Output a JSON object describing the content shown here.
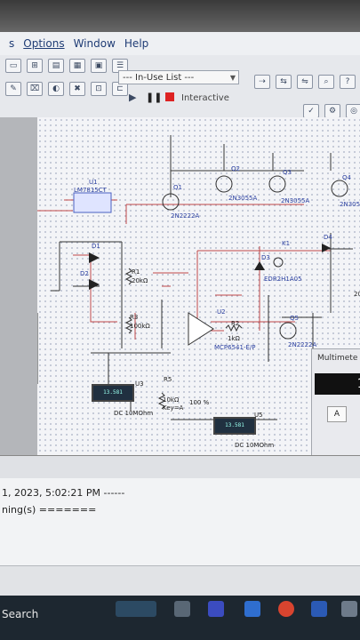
{
  "menubar": {
    "items": [
      "s",
      "Options",
      "Window",
      "Help"
    ]
  },
  "toolbar": {
    "inuse_list": "--- In-Use List ---",
    "mode_label": "Interactive",
    "icons": [
      "component-icon",
      "graph-icon",
      "database-icon",
      "probe-icon",
      "play-icon",
      "pause-icon",
      "stop-icon"
    ]
  },
  "schematic": {
    "labels": {
      "u1_ref": "U1",
      "u1_part": "LM7815CT",
      "q1": "Q1",
      "q1_part": "2N2222A",
      "q2": "Q2",
      "q2_part": "2N3055A",
      "q3": "Q3",
      "q3_part": "2N3055A",
      "q4": "Q4",
      "q4_part": "2N305",
      "d1": "D1",
      "d2": "D2",
      "d3": "D3",
      "d4": "D4",
      "k1": "K1",
      "k1_part": "EDR2H1A05",
      "r1": "R1",
      "r1_val": "20kΩ",
      "r3": "R3",
      "r3_val": "100kΩ",
      "u2": "U2",
      "u2_part": "MCP6541-E/P",
      "r2": "R2",
      "r2_val": "1kΩ",
      "q5": "Q5",
      "q5_part": "2N2222A",
      "r5": "R5",
      "r5_val": "10kΩ",
      "r5_key": "Key=A",
      "r5_pct": "100 %",
      "u3": "U3",
      "u3_mode": "DC  10MOhm",
      "u5": "U5",
      "u5_mode": "DC  10MOhm",
      "meter_reading": "13.581",
      "right_cut": "20"
    }
  },
  "multimeter": {
    "title": "Multimete",
    "display": "1",
    "button_a": "A"
  },
  "output": {
    "line1": "1, 2023, 5:02:21 PM ------",
    "line2": "ning(s) ======="
  },
  "taskbar": {
    "search": "Search"
  }
}
